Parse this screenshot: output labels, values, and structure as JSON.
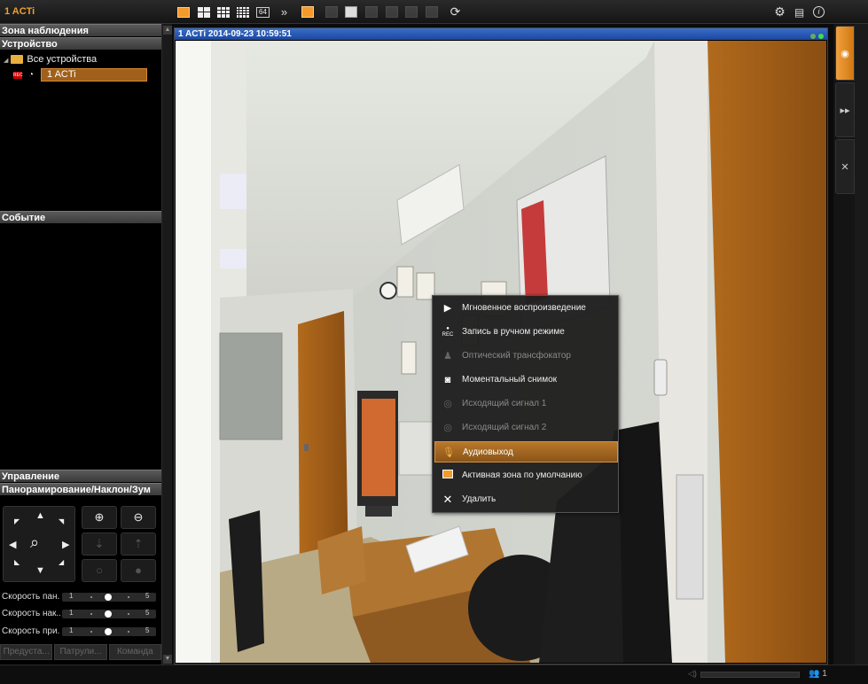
{
  "app": {
    "title": "1 ACTi"
  },
  "toolbar": {
    "layout_64_label": "64",
    "more_label": "»"
  },
  "left": {
    "surveillance_zone": "Зона наблюдения",
    "device_header": "Устройство",
    "all_devices": "Все устройства",
    "selected_device": "1 ACTi",
    "rec_badge": "REC",
    "event_header": "Событие",
    "control_header": "Управление",
    "ptz_header": "Панорамирование/Наклон/Зум",
    "speeds": [
      {
        "label": "Скорость пан...",
        "min": "1",
        "max": "5",
        "value": 3
      },
      {
        "label": "Скорость нак...",
        "min": "1",
        "max": "5",
        "value": 3
      },
      {
        "label": "Скорость при...",
        "min": "1",
        "max": "5",
        "value": 3
      }
    ],
    "bottom_buttons": [
      "Предуста...",
      "Патрули...",
      "Команда"
    ]
  },
  "video": {
    "title": "1 ACTi   2014-09-23 10:59:51"
  },
  "context_menu": {
    "items": [
      {
        "label": "Мгновенное воспроизведение",
        "icon": "play-icon",
        "state": "enabled"
      },
      {
        "label": "Запись в ручном режиме",
        "icon": "rec-icon",
        "state": "enabled"
      },
      {
        "label": "Оптический трансфокатор",
        "icon": "optical-zoom-icon",
        "state": "disabled"
      },
      {
        "label": "Моментальный снимок",
        "icon": "camera-icon",
        "state": "enabled"
      },
      {
        "label": "Исходящий сигнал 1",
        "icon": "output-signal-icon",
        "state": "disabled"
      },
      {
        "label": "Исходящий сигнал 2",
        "icon": "output-signal-icon",
        "state": "disabled"
      },
      {
        "label": "Аудиовыход",
        "icon": "microphone-icon",
        "state": "active"
      },
      {
        "label": "Активная зона по умолчанию",
        "icon": "active-zone-icon",
        "state": "enabled"
      },
      {
        "label": "Удалить",
        "icon": "close-icon",
        "state": "enabled"
      }
    ]
  },
  "status": {
    "users_count": "1"
  },
  "colors": {
    "accent": "#f39a2c",
    "title_bar": "#1a46a0",
    "menu_active": "#a66a22"
  }
}
